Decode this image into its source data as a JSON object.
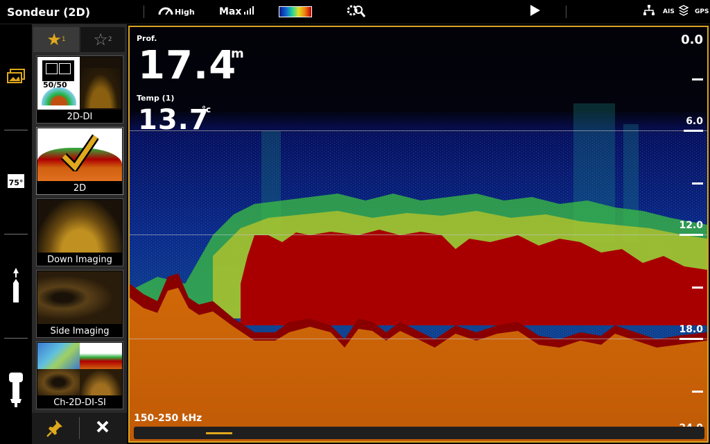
{
  "header": {
    "title": "Sondeur (2D)",
    "sensitivity_label": "High",
    "range_label": "Max",
    "icons": [
      "speed-gauge-icon",
      "signal-bars-icon",
      "color-palette-icon",
      "gear-search-icon",
      "play-icon",
      "network-icon",
      "ais-icon",
      "layers-icon",
      "gps-icon"
    ],
    "ais_text": "AIS",
    "gps_text": "GPS"
  },
  "left_rail": {
    "icons": [
      "images-icon",
      "temperature-icon",
      "boat-icon",
      "outboard-motor-icon"
    ],
    "temp_badge": "75°"
  },
  "favorites": {
    "tabs": [
      {
        "label": "★",
        "sub": "1"
      },
      {
        "label": "☆",
        "sub": "2"
      }
    ],
    "tiles": [
      {
        "label": "2D-DI",
        "badge": "50/50"
      },
      {
        "label": "2D"
      },
      {
        "label": "Down Imaging"
      },
      {
        "label": "Side Imaging"
      },
      {
        "label": "Ch-2D-DI-SI"
      }
    ],
    "bottom_icons": [
      "pin-icon",
      "close-icon"
    ]
  },
  "sonar": {
    "depth_label": "Prof.",
    "depth_value": "17.4",
    "depth_unit": "m",
    "temp_label": "Temp (1)",
    "temp_value": "13.7",
    "temp_unit": "°c",
    "scale": [
      "0.0",
      "6.0",
      "12.0",
      "18.0",
      "24.0"
    ],
    "frequency": "150-250 kHz",
    "colors": {
      "bottom": "#c85a08",
      "hard": "#8a0000",
      "water": "#0a1a6a",
      "accent": "#d9a524"
    }
  }
}
